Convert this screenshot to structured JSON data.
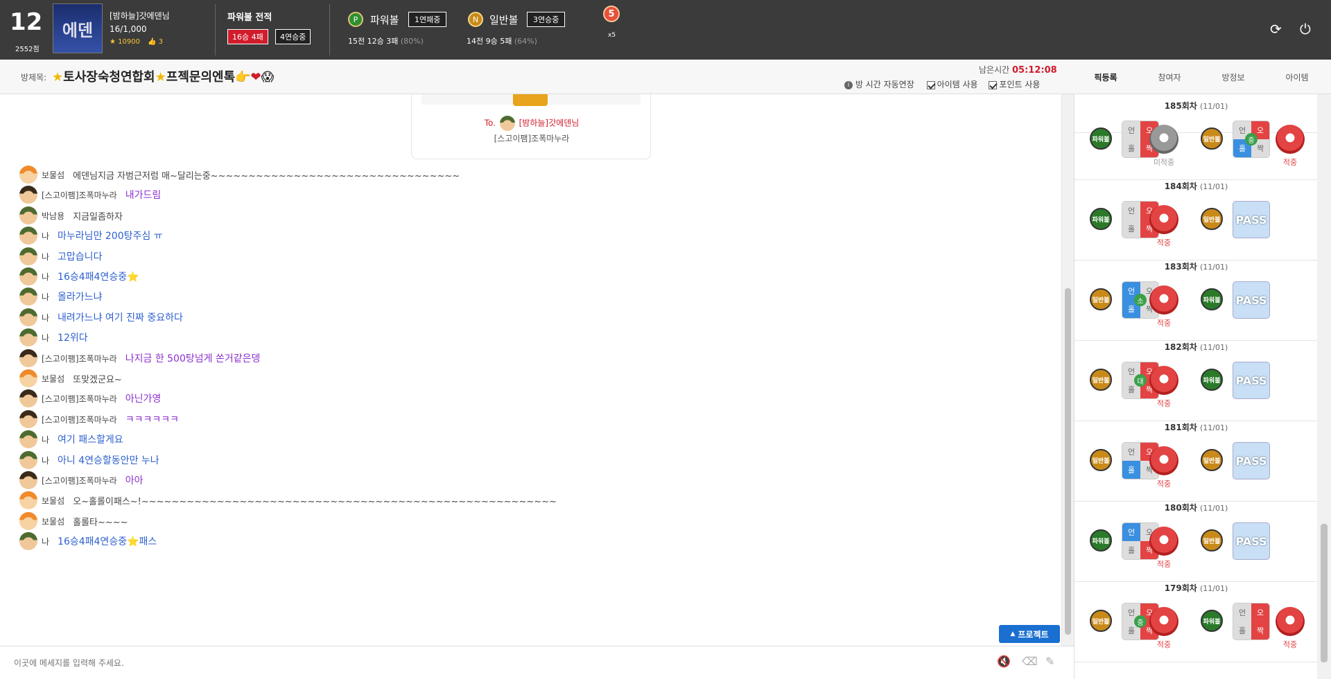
{
  "header": {
    "level": "12",
    "points": "2552점",
    "username": "[밤하늘]갓에덴님",
    "progress_text": "16/1,000",
    "coins": "10900",
    "likes": "3",
    "stats_title": "파워볼 전적",
    "record_badge": "16승 4패",
    "streak_badge": "4연승중",
    "power_ball_label": "파워볼",
    "power_ball_letter": "P",
    "power_ball_streak": "1연패중",
    "power_ball_stats": "15전 12승 3패",
    "power_ball_pct": "(80%)",
    "normal_ball_label": "일반볼",
    "normal_ball_letter": "N",
    "normal_ball_streak": "3연승중",
    "normal_ball_stats": "14전 9승 5패",
    "normal_ball_pct": "(64%)",
    "medal_number": "5",
    "medal_mult": "x5"
  },
  "room": {
    "title_label": "방제목:",
    "title": "토사장숙청연합회",
    "title_suffix": "프젝문의엔톡",
    "time_label": "남은시간",
    "time_value": "05:12:08",
    "auto_extend": "방 시간 자동연장",
    "use_item": "아이템 사용",
    "use_point": "포인트 사용"
  },
  "tabs": [
    "픽등록",
    "참여자",
    "방정보",
    "아이템"
  ],
  "gift": {
    "to_label": "To.",
    "to_name": "[밤하늘]갓에덴님",
    "from_name": "[스고이팸]조폭마누라"
  },
  "messages": [
    {
      "avatar": "orange",
      "nick": "보물섬",
      "text": "에덴님지금 자범근저럼 매~달리는중~~~~~~~~~~~~~~~~~~~~~~~~~~~~~~~~~",
      "style": "plain"
    },
    {
      "avatar": "black",
      "nick": "[스고이팸]조폭마누라",
      "text": "내가드림",
      "style": "purple"
    },
    {
      "avatar": "soldier",
      "nick": "박남용",
      "text": "지금일좀하자",
      "style": "plain"
    },
    {
      "avatar": "soldier",
      "nick": "나",
      "text": "마누라님만 200탕주심 ㅠ",
      "style": "blue"
    },
    {
      "avatar": "soldier",
      "nick": "나",
      "text": "고맙습니다",
      "style": "blue"
    },
    {
      "avatar": "soldier",
      "nick": "나",
      "text": "16승4패4연승중⭐",
      "style": "blue"
    },
    {
      "avatar": "soldier",
      "nick": "나",
      "text": "올라가느냐",
      "style": "blue"
    },
    {
      "avatar": "soldier",
      "nick": "나",
      "text": "내려가느냐 여기 진짜 중요하다",
      "style": "blue"
    },
    {
      "avatar": "soldier",
      "nick": "나",
      "text": "12위다",
      "style": "blue"
    },
    {
      "avatar": "black",
      "nick": "[스고이팸]조폭마누라",
      "text": "나지금 한 500탕넘게 쏜거같은뎅",
      "style": "purple"
    },
    {
      "avatar": "orange",
      "nick": "보물섬",
      "text": "또맞겠군요~",
      "style": "plain"
    },
    {
      "avatar": "black",
      "nick": "[스고이팸]조폭마누라",
      "text": "아닌가영",
      "style": "purple"
    },
    {
      "avatar": "black",
      "nick": "[스고이팸]조폭마누라",
      "text": "ㅋㅋㅋㅋㅋㅋ",
      "style": "purple"
    },
    {
      "avatar": "soldier",
      "nick": "나",
      "text": "여기 패스할게요",
      "style": "blue"
    },
    {
      "avatar": "soldier",
      "nick": "나",
      "text": "아니 4연승할동안만 누나",
      "style": "blue"
    },
    {
      "avatar": "black",
      "nick": "[스고이팸]조폭마누라",
      "text": "아아",
      "style": "purple"
    },
    {
      "avatar": "orange",
      "nick": "보물섬",
      "text": "오~홀롤이패스~!~~~~~~~~~~~~~~~~~~~~~~~~~~~~~~~~~~~~~~~~~~~~~~~~~~~~~~~",
      "style": "plain"
    },
    {
      "avatar": "orange",
      "nick": "보물섬",
      "text": "홀롤타~~~~",
      "style": "plain"
    },
    {
      "avatar": "soldier",
      "nick": "나",
      "text": "16승4패4연승중⭐패스",
      "style": "blue"
    }
  ],
  "project_button": "프로젝트",
  "input_placeholder": "이곳에 메세지를 입력해 주세요.",
  "rounds": [
    {
      "title": "185회차",
      "date": "(11/01)"
    },
    {
      "title": "184회차",
      "date": "(11/01)"
    },
    {
      "title": "183회차",
      "date": "(11/01)"
    },
    {
      "title": "182회차",
      "date": "(11/01)"
    },
    {
      "title": "181회차",
      "date": "(11/01)"
    },
    {
      "title": "180회차",
      "date": "(11/01)"
    },
    {
      "title": "179회차",
      "date": "(11/01)"
    }
  ],
  "labels": {
    "power": "파워볼",
    "normal": "일반볼",
    "hit": "적중",
    "miss": "미적중",
    "pass": "PASS",
    "un": "언",
    "o": "오",
    "hol": "홀",
    "jjak": "짝",
    "so": "소",
    "jung": "중",
    "dae": "대"
  }
}
